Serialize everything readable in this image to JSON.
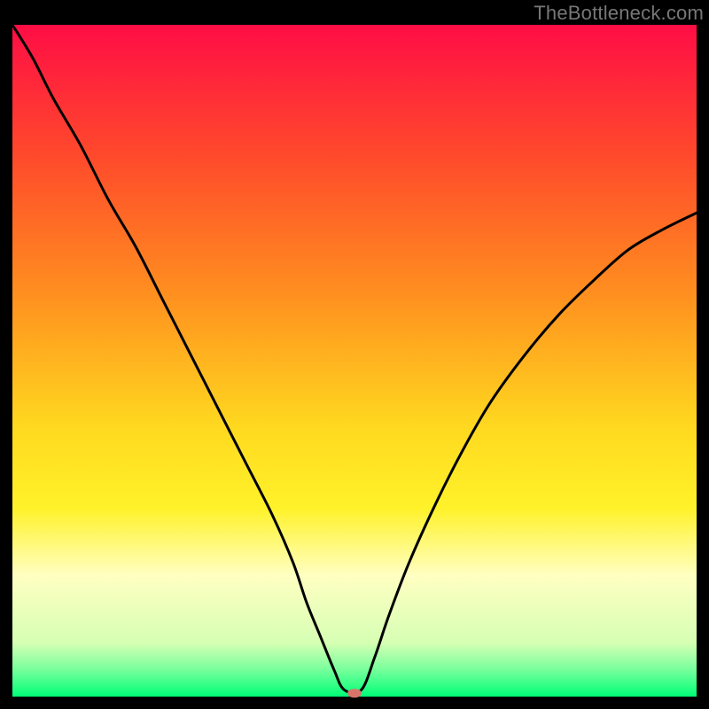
{
  "watermark": "TheBottleneck.com",
  "chart_data": {
    "type": "line",
    "title": "",
    "xlabel": "",
    "ylabel": "",
    "xlim": [
      0,
      100
    ],
    "ylim": [
      0,
      100
    ],
    "background": {
      "type": "vertical-gradient",
      "stops": [
        {
          "offset": 0,
          "color": "#ff0d45"
        },
        {
          "offset": 20,
          "color": "#ff4b2b"
        },
        {
          "offset": 40,
          "color": "#ff8f1f"
        },
        {
          "offset": 60,
          "color": "#ffd91f"
        },
        {
          "offset": 72,
          "color": "#fff22a"
        },
        {
          "offset": 82,
          "color": "#ffffc2"
        },
        {
          "offset": 92,
          "color": "#d6ffb4"
        },
        {
          "offset": 96,
          "color": "#77ff9c"
        },
        {
          "offset": 100,
          "color": "#00ff77"
        }
      ]
    },
    "border_color": "#000000",
    "border_width_top": 28,
    "border_width_bottom": 14,
    "border_width_sides": 14,
    "series": [
      {
        "name": "bottleneck-curve",
        "color": "#000000",
        "width": 3,
        "x": [
          0,
          3,
          6,
          10,
          14,
          18,
          22,
          26,
          30,
          34,
          38,
          41,
          43,
          45,
          47,
          48.5,
          51,
          53,
          55,
          58,
          62,
          66,
          70,
          75,
          80,
          85,
          90,
          95,
          100
        ],
        "values": [
          100,
          95,
          89,
          82,
          74,
          67,
          59,
          51,
          43,
          35,
          27,
          20,
          14,
          9,
          4,
          1,
          1,
          6,
          12,
          20,
          29,
          37,
          44,
          51,
          57,
          62,
          66.5,
          69.5,
          72
        ]
      }
    ],
    "marker": {
      "name": "bottleneck-point",
      "x": 50,
      "y": 0.5,
      "color": "#d6746b",
      "rx": 8,
      "ry": 5
    }
  }
}
